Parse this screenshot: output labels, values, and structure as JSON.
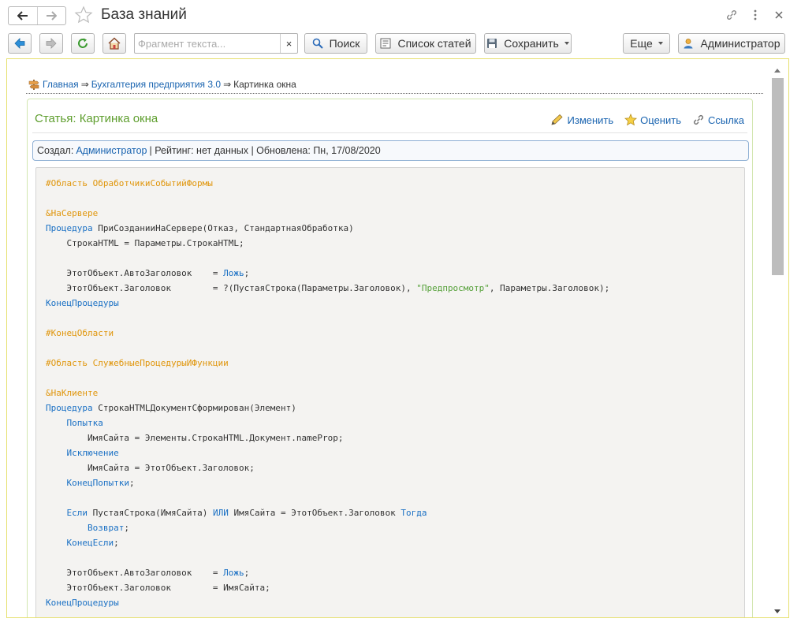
{
  "window": {
    "title": "База знаний"
  },
  "toolbar": {
    "search_placeholder": "Фрагмент текста...",
    "clear": "×",
    "search_label": "Поиск",
    "articles_label": "Список статей",
    "save_label": "Сохранить",
    "more_label": "Еще",
    "user_label": "Администратор"
  },
  "breadcrumb": {
    "home": "Главная",
    "sep1": "⇒",
    "section": "Бухгалтерия предприятия 3.0",
    "sep2": "⇒",
    "current": "Картинка окна"
  },
  "article": {
    "title": "Статья: Картинка окна",
    "edit_label": "Изменить",
    "rate_label": "Оценить",
    "link_label": "Ссылка",
    "meta": {
      "created_label": "Создал:",
      "author": "Администратор",
      "rating": "| Рейтинг: нет данных | Обновлена: Пн, 17/08/2020"
    }
  },
  "code": {
    "lines": [
      [
        {
          "t": "#Область ОбработчикиСобытийФормы",
          "c": "pp"
        }
      ],
      [],
      [
        {
          "t": "&НаСервере",
          "c": "pp"
        }
      ],
      [
        {
          "t": "Процедура",
          "c": "kw"
        },
        {
          "t": " ПриСозданииНаСервере(Отказ, СтандартнаяОбработка)",
          "c": ""
        }
      ],
      [
        {
          "t": "    СтрокаHTML = Параметры.СтрокаHTML;",
          "c": ""
        }
      ],
      [],
      [
        {
          "t": "    ЭтотОбъект.АвтоЗаголовок    = ",
          "c": ""
        },
        {
          "t": "Ложь",
          "c": "kw"
        },
        {
          "t": ";",
          "c": ""
        }
      ],
      [
        {
          "t": "    ЭтотОбъект.Заголовок        = ?(ПустаяСтрока(Параметры.Заголовок), ",
          "c": ""
        },
        {
          "t": "\"Предпросмотр\"",
          "c": "str"
        },
        {
          "t": ", Параметры.Заголовок);",
          "c": ""
        }
      ],
      [
        {
          "t": "КонецПроцедуры",
          "c": "kw"
        }
      ],
      [],
      [
        {
          "t": "#КонецОбласти",
          "c": "pp"
        }
      ],
      [],
      [
        {
          "t": "#Область СлужебныеПроцедурыИФункции",
          "c": "pp"
        }
      ],
      [],
      [
        {
          "t": "&НаКлиенте",
          "c": "pp"
        }
      ],
      [
        {
          "t": "Процедура",
          "c": "kw"
        },
        {
          "t": " СтрокаHTMLДокументСформирован(Элемент)",
          "c": ""
        }
      ],
      [
        {
          "t": "    ",
          "c": ""
        },
        {
          "t": "Попытка",
          "c": "kw"
        }
      ],
      [
        {
          "t": "        ИмяСайта = Элементы.СтрокаHTML.Документ.nameProp;",
          "c": ""
        }
      ],
      [
        {
          "t": "    ",
          "c": ""
        },
        {
          "t": "Исключение",
          "c": "kw"
        }
      ],
      [
        {
          "t": "        ИмяСайта = ЭтотОбъект.Заголовок;",
          "c": ""
        }
      ],
      [
        {
          "t": "    ",
          "c": ""
        },
        {
          "t": "КонецПопытки",
          "c": "kw"
        },
        {
          "t": ";",
          "c": ""
        }
      ],
      [],
      [
        {
          "t": "    ",
          "c": ""
        },
        {
          "t": "Если",
          "c": "kw"
        },
        {
          "t": " ПустаяСтрока(ИмяСайта) ",
          "c": ""
        },
        {
          "t": "ИЛИ",
          "c": "kw"
        },
        {
          "t": " ИмяСайта = ЭтотОбъект.Заголовок ",
          "c": ""
        },
        {
          "t": "Тогда",
          "c": "kw"
        }
      ],
      [
        {
          "t": "        ",
          "c": ""
        },
        {
          "t": "Возврат",
          "c": "kw"
        },
        {
          "t": ";",
          "c": ""
        }
      ],
      [
        {
          "t": "    ",
          "c": ""
        },
        {
          "t": "КонецЕсли",
          "c": "kw"
        },
        {
          "t": ";",
          "c": ""
        }
      ],
      [],
      [
        {
          "t": "    ЭтотОбъект.АвтоЗаголовок    = ",
          "c": ""
        },
        {
          "t": "Ложь",
          "c": "kw"
        },
        {
          "t": ";",
          "c": ""
        }
      ],
      [
        {
          "t": "    ЭтотОбъект.Заголовок        = ИмяСайта;",
          "c": ""
        }
      ],
      [
        {
          "t": "КонецПроцедуры",
          "c": "kw"
        }
      ]
    ]
  }
}
